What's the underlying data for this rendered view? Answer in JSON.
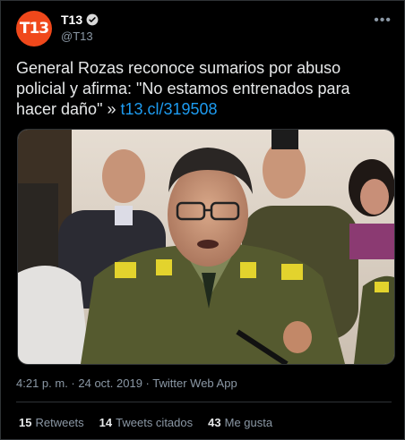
{
  "account": {
    "display_name": "T13",
    "handle": "@T13",
    "avatar_text": "T13",
    "brand_color": "#f0481b",
    "verified_icon": "verified-badge-icon"
  },
  "tweet": {
    "text": "General Rozas reconoce sumarios por abuso policial y afirma: \"No estamos entrenados para hacer daño\" » ",
    "link": "t13.cl/319508",
    "link_color": "#1d9bf0"
  },
  "meta": {
    "time": "4:21 p. m.",
    "separator": " · ",
    "date": "24 oct. 2019",
    "source": "Twitter Web App"
  },
  "stats": {
    "retweets_count": "15",
    "retweets_label": "Retweets",
    "quotes_count": "14",
    "quotes_label": "Tweets citados",
    "likes_count": "43",
    "likes_label": "Me gusta"
  },
  "colors": {
    "background": "#000000",
    "text": "#e7e9ea",
    "secondary": "#8b98a5",
    "border": "#2f3336"
  }
}
